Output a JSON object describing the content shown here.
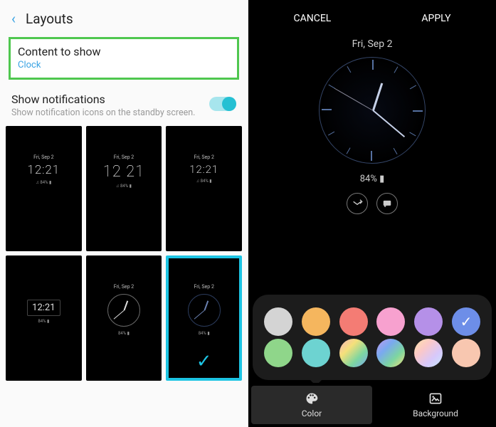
{
  "left": {
    "header_title": "Layouts",
    "content_to_show": {
      "title": "Content to show",
      "value": "Clock"
    },
    "show_notifications": {
      "title": "Show notifications",
      "subtitle": "Show notification icons on the standby screen.",
      "enabled": true
    },
    "layouts": [
      {
        "id": "digital-1221",
        "date": "Fri, Sep 2",
        "time": "12:21",
        "meta": "♫\n84% ▮",
        "selected": false
      },
      {
        "id": "digital-1221-big",
        "date": "Fri, Sep 2",
        "time": "12 21",
        "meta": "♫\n84% ▮",
        "selected": false
      },
      {
        "id": "digital-1221-alt",
        "date": "Fri, Sep 2",
        "time": "12:21",
        "meta": "♫\n84% ▮",
        "selected": false
      },
      {
        "id": "digital-box",
        "date": "",
        "time": "12:21",
        "meta": "84% ▮",
        "selected": false
      },
      {
        "id": "analog-white",
        "date": "Fri, Sep 2",
        "time": "",
        "meta": "84% ▮",
        "selected": false
      },
      {
        "id": "analog-blue",
        "date": "Fri, Sep 2",
        "time": "",
        "meta": "84% ▮",
        "selected": true
      }
    ]
  },
  "right": {
    "cancel": "CANCEL",
    "apply": "APPLY",
    "preview": {
      "date": "Fri, Sep 2",
      "battery": "84% ▮"
    },
    "colors_row1": [
      {
        "name": "grey",
        "color": "#d4d4d4"
      },
      {
        "name": "orange",
        "color": "#f5b65e"
      },
      {
        "name": "coral",
        "color": "#f47c74"
      },
      {
        "name": "pink",
        "color": "#f7a1cf"
      },
      {
        "name": "purple",
        "color": "#b590e8"
      },
      {
        "name": "blue",
        "color": "#6d8ee8",
        "selected": true
      }
    ],
    "colors_row2": [
      {
        "name": "green",
        "color": "#8fd68a"
      },
      {
        "name": "teal",
        "color": "#6dd3d1"
      },
      {
        "name": "rainbow1",
        "gradient": "linear-gradient(135deg,#f8b5c0,#f5e07a,#7dd6a0,#7aa9f0)"
      },
      {
        "name": "rainbow2",
        "gradient": "linear-gradient(135deg,#c19af0,#7aa9f0,#7dd6a0,#f5e07a)"
      },
      {
        "name": "pastel",
        "gradient": "linear-gradient(135deg,#fde2a7,#fbc8c8,#d7c8fb,#c8e7fb)"
      },
      {
        "name": "peach",
        "color": "#f8c7b0"
      }
    ],
    "tabs": {
      "color": "Color",
      "background": "Background",
      "active": "color"
    }
  }
}
